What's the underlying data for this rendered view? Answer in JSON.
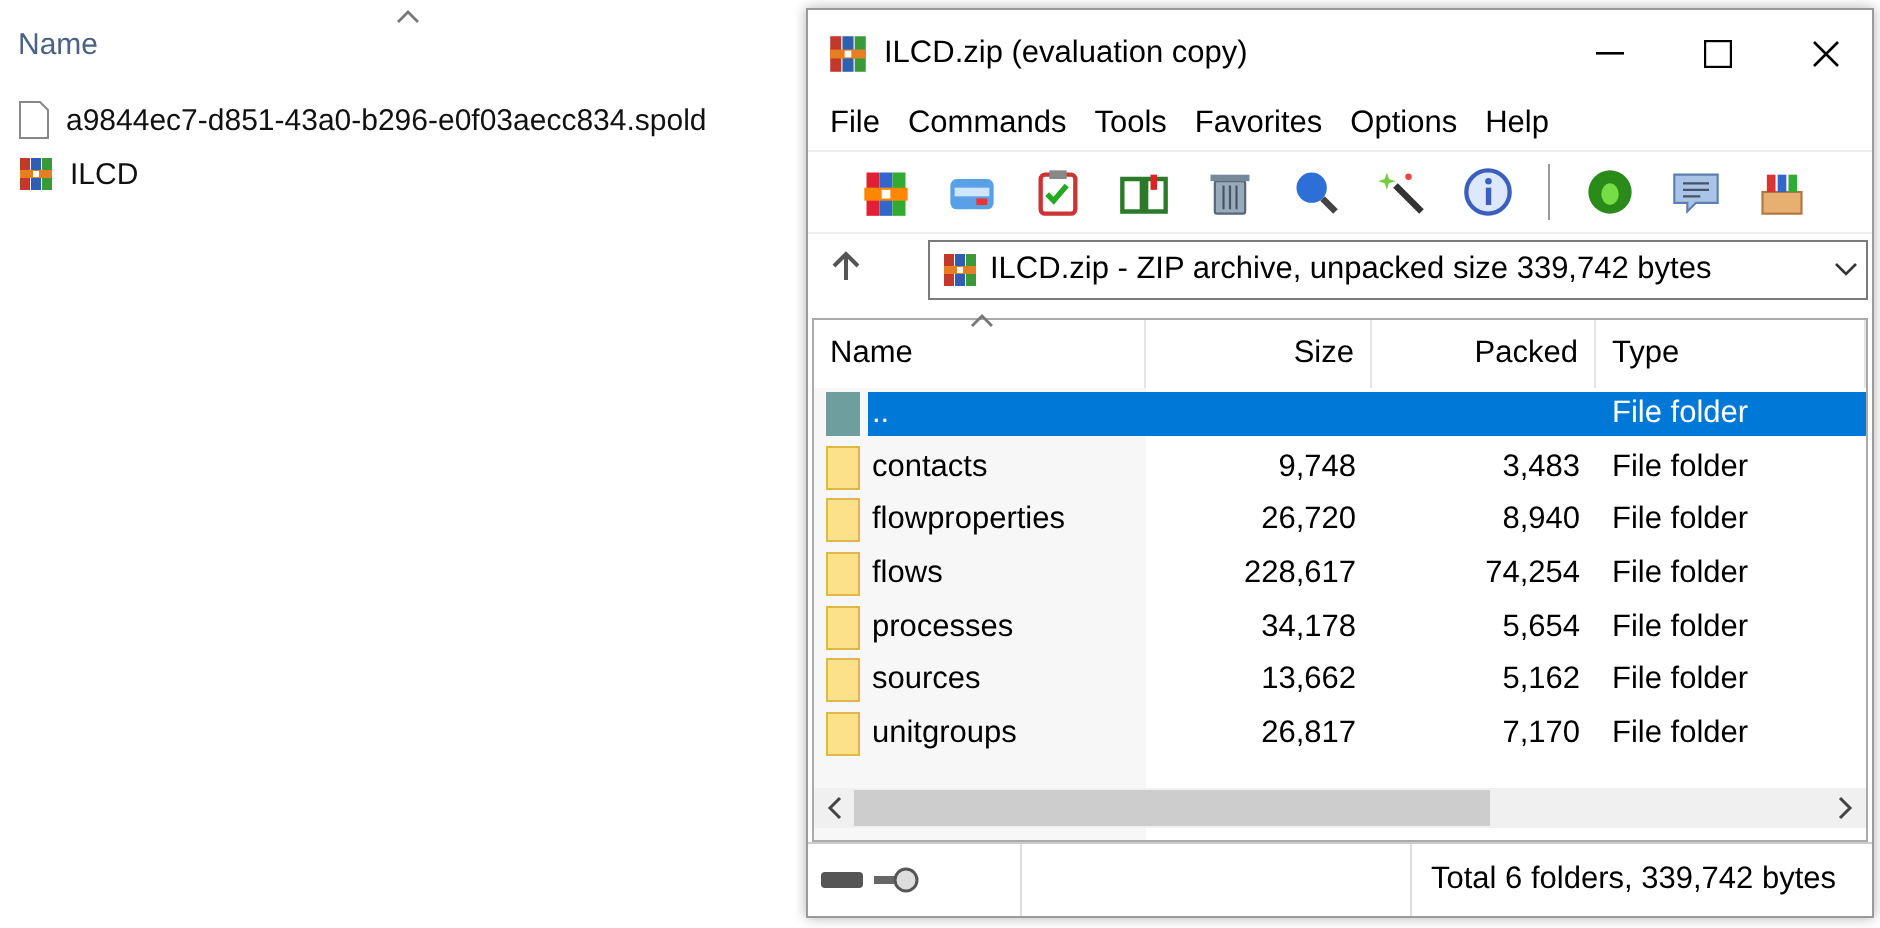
{
  "explorer": {
    "column": "Name",
    "files": [
      {
        "name": "a9844ec7-d851-43a0-b296-e0f03aecc834.spold",
        "kind": "file"
      },
      {
        "name": "ILCD",
        "kind": "archive"
      }
    ]
  },
  "window": {
    "title": "ILCD.zip (evaluation copy)"
  },
  "menu": [
    "File",
    "Commands",
    "Tools",
    "Favorites",
    "Options",
    "Help"
  ],
  "address": {
    "value": "ILCD.zip - ZIP archive, unpacked size 339,742 bytes"
  },
  "table": {
    "columns": [
      "Name",
      "Size",
      "Packed",
      "Type"
    ],
    "rows": [
      {
        "kind": "parent",
        "name": "..",
        "size": "",
        "packed": "",
        "type": "File folder",
        "selected": true
      },
      {
        "kind": "folder",
        "name": "contacts",
        "size": "9,748",
        "packed": "3,483",
        "type": "File folder",
        "selected": false
      },
      {
        "kind": "folder",
        "name": "flowproperties",
        "size": "26,720",
        "packed": "8,940",
        "type": "File folder",
        "selected": false
      },
      {
        "kind": "folder",
        "name": "flows",
        "size": "228,617",
        "packed": "74,254",
        "type": "File folder",
        "selected": false
      },
      {
        "kind": "folder",
        "name": "processes",
        "size": "34,178",
        "packed": "5,654",
        "type": "File folder",
        "selected": false
      },
      {
        "kind": "folder",
        "name": "sources",
        "size": "13,662",
        "packed": "5,162",
        "type": "File folder",
        "selected": false
      },
      {
        "kind": "folder",
        "name": "unitgroups",
        "size": "26,817",
        "packed": "7,170",
        "type": "File folder",
        "selected": false
      }
    ]
  },
  "status_bar": "Total 6 folders, 339,742 bytes"
}
